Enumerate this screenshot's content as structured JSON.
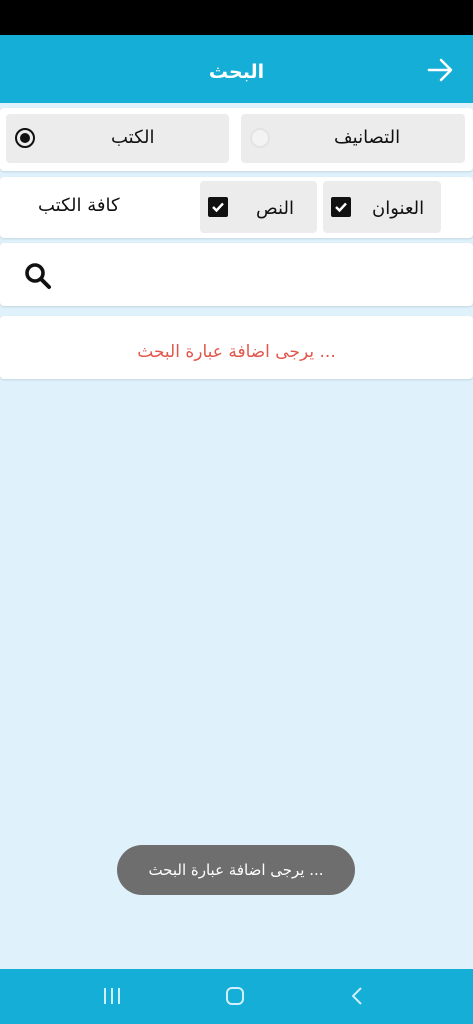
{
  "header": {
    "title": "البحث",
    "back_icon": "arrow-right-icon"
  },
  "search_scope": {
    "books_label": "الكتب",
    "categories_label": "التصانيف",
    "selected": "books"
  },
  "filters": {
    "title_label": "العنوان",
    "title_checked": true,
    "text_label": "النص",
    "text_checked": true,
    "all_books_label": "كافة الكتب"
  },
  "search": {
    "value": "",
    "placeholder": "",
    "icon": "search-icon"
  },
  "hint": {
    "message": "يرجى اضافة عبارة البحث ..."
  },
  "toast": {
    "message": "يرجى اضافة عبارة البحث ..."
  },
  "colors": {
    "primary": "#14aed6",
    "background": "#dff2fb",
    "hint": "#e2574c",
    "toast": "#6e6e6e"
  }
}
